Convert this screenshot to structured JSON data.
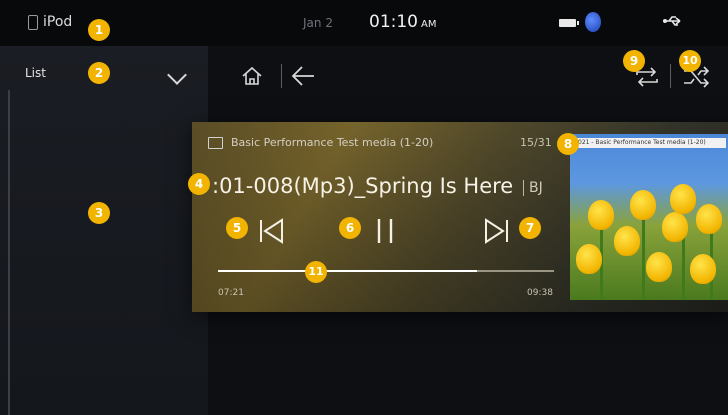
{
  "status_bar": {
    "source": "iPod",
    "date": "Jan 2",
    "time": "01:10",
    "ampm": "AM"
  },
  "sidebar": {
    "list_label": "List"
  },
  "player": {
    "folder": "Basic Performance Test media (1-20)",
    "track_count": "15/31",
    "song_title": ":01-008(Mp3)_Spring Is Here",
    "artist": "BJ",
    "elapsed": "07:21",
    "total": "09:38",
    "progress": 0.77,
    "album_art_caption": "021 - Basic Performance Test media (1-20)"
  },
  "badges": [
    "1",
    "2",
    "3",
    "4",
    "5",
    "6",
    "7",
    "8",
    "9",
    "10",
    "11"
  ],
  "colors": {
    "badge": "#f2b400",
    "background": "#0d0f13"
  }
}
